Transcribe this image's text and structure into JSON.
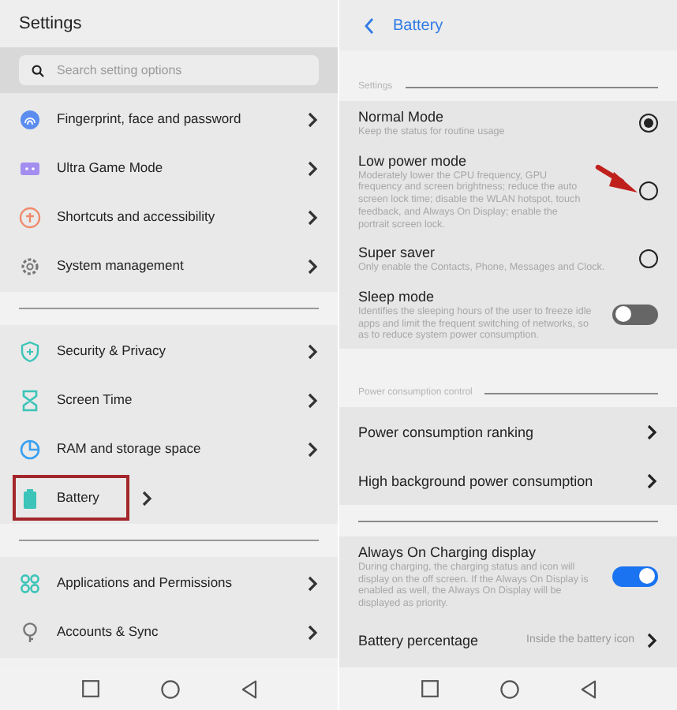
{
  "settings_screen": {
    "title": "Settings",
    "search": {
      "placeholder": "Search setting options"
    },
    "groups": [
      {
        "items": [
          {
            "label": "Fingerprint, face and password",
            "highlighted": false
          },
          {
            "label": "Ultra Game Mode",
            "highlighted": false
          },
          {
            "label": "Shortcuts and accessibility",
            "highlighted": false
          },
          {
            "label": "System management",
            "highlighted": false
          }
        ]
      },
      {
        "items": [
          {
            "label": "Security & Privacy",
            "highlighted": false
          },
          {
            "label": "Screen Time",
            "highlighted": false
          },
          {
            "label": "RAM and storage space",
            "highlighted": false
          },
          {
            "label": "Battery",
            "highlighted": true
          }
        ]
      },
      {
        "items": [
          {
            "label": "Applications and Permissions",
            "highlighted": false
          },
          {
            "label": "Accounts & Sync",
            "highlighted": false
          }
        ]
      }
    ]
  },
  "battery_screen": {
    "title": "Battery",
    "sections": [
      {
        "label": "Settings",
        "items": [
          {
            "kind": "radio",
            "title": "Normal Mode",
            "description": "Keep the status for routine usage",
            "selected": true,
            "annotated": false
          },
          {
            "kind": "radio",
            "title": "Low power mode",
            "description": "Moderately lower the CPU frequency, GPU frequency and screen brightness; reduce the auto screen lock time; disable the WLAN hotspot, touch feedback, and Always On Display; enable the portrait screen lock.",
            "selected": false,
            "annotated": true
          },
          {
            "kind": "radio",
            "title": "Super saver",
            "description": "Only enable the Contacts, Phone, Messages and Clock.",
            "selected": false,
            "annotated": false
          },
          {
            "kind": "toggle",
            "title": "Sleep mode",
            "description": "Identifies the sleeping hours of the user to freeze idle apps and limit the frequent switching of networks, so as to reduce system power consumption.",
            "on": false
          }
        ]
      },
      {
        "label": "Power consumption control",
        "items": [
          {
            "kind": "link",
            "title": "Power consumption ranking"
          },
          {
            "kind": "link",
            "title": "High background power consumption"
          }
        ]
      },
      {
        "items": [
          {
            "kind": "toggle",
            "title": "Always On Charging display",
            "description": "During charging, the charging status and icon will display on the off screen. If the Always On Display is enabled as well, the Always On Display will be displayed as priority.",
            "on": true
          },
          {
            "kind": "link",
            "title": "Battery percentage",
            "value": "Inside the battery icon"
          }
        ]
      }
    ]
  }
}
